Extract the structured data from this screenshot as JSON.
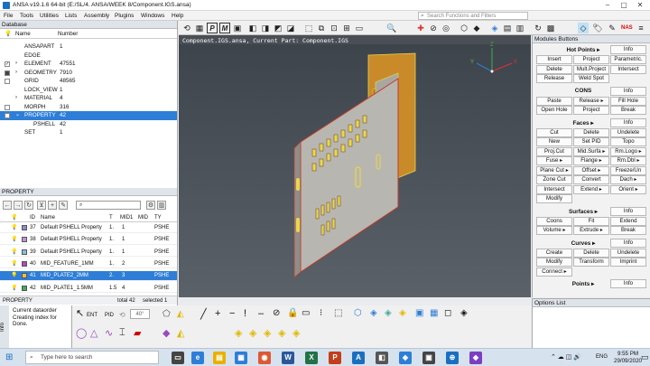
{
  "app": {
    "title": "ANSA v19.1.6 64-bit (E:/SL/4. ANSA/WEEK 8/Component.IGS.ansa)"
  },
  "menu": [
    "File",
    "Tools",
    "Utilities",
    "Lists",
    "Assembly",
    "Plugins",
    "Windows",
    "Help"
  ],
  "search": {
    "placeholder": "Search Functions and Filters"
  },
  "database": {
    "title": "Database",
    "col_name": "Name",
    "col_number": "Number",
    "rows": [
      {
        "name": "ANSAPART",
        "number": "1"
      },
      {
        "name": "EDGE",
        "number": ""
      },
      {
        "name": "ELEMENT",
        "number": "47551"
      },
      {
        "name": "GEOMETRY",
        "number": "7910"
      },
      {
        "name": "GRID",
        "number": "48565"
      },
      {
        "name": "LOCK_VIEW",
        "number": "1"
      },
      {
        "name": "MATERIAL",
        "number": "4"
      },
      {
        "name": "MORPH",
        "number": "316"
      },
      {
        "name": "PROPERTY",
        "number": "42"
      },
      {
        "name": "PSHELL",
        "number": "42"
      },
      {
        "name": "SET",
        "number": "1"
      }
    ]
  },
  "property": {
    "title": "PROPERTY",
    "headers": {
      "id": "ID",
      "name": "Name",
      "t": "T",
      "mid1": "MID1",
      "mid": "MID",
      "type": "TY"
    },
    "rows": [
      {
        "id": "37",
        "name": "Default PSHELL Property",
        "t": "1.",
        "mid1": "1",
        "type": "PSHE",
        "color": "#8a8ad0"
      },
      {
        "id": "38",
        "name": "Default PSHELL Property",
        "t": "1.",
        "mid1": "1",
        "type": "PSHE",
        "color": "#c98fd0"
      },
      {
        "id": "39",
        "name": "Default PSHELL Property",
        "t": "1.",
        "mid1": "1",
        "type": "PSHE",
        "color": "#8bc0e0"
      },
      {
        "id": "40",
        "name": "MID_FEATURE_1MM",
        "t": "1.",
        "mid1": "2",
        "type": "PSHE",
        "color": "#b04ab8"
      },
      {
        "id": "41",
        "name": "MID_PLATE2_2MM",
        "t": "2.",
        "mid1": "3",
        "type": "PSHE",
        "color": "#e8c23a"
      },
      {
        "id": "42",
        "name": "MID_PLATE1_1.5MM",
        "t": "1.5",
        "mid1": "4",
        "type": "PSHE",
        "color": "#3fae4c"
      }
    ],
    "footer_label": "PROPERTY",
    "footer_total": "total 42",
    "footer_selected": "selected 1"
  },
  "viewport": {
    "header": "Component.IGS.ansa,  Current Part: Component.IGS"
  },
  "modules": {
    "title": "Modules Buttons",
    "info": "Info",
    "hotpoints": {
      "title": "Hot Points ▸",
      "buttons": [
        "Insert",
        "Project",
        "Parametric.",
        "Delete",
        "Mult.Project",
        "Intersect",
        "Release",
        "Weld Spot"
      ]
    },
    "cons": {
      "title": "CONS",
      "buttons": [
        "Paste",
        "Release ▸",
        "Fill Hole",
        "Open Hole",
        "Project",
        "Break"
      ]
    },
    "faces": {
      "title": "Faces ▸",
      "buttons": [
        "Cut",
        "Delete",
        "Undelete",
        "New",
        "Set PID",
        "Topo",
        "Proj.Cut",
        "Mid.Surfa ▸",
        "Rm.Logo ▸",
        "Fuse ▸",
        "Flange ▸",
        "Rm.Dbl ▸",
        "Plane Cut ▸",
        "Offset ▸",
        "Freeze/Un",
        "Zone Cut",
        "Convert",
        "Dach ▸",
        "Intersect",
        "Extend ▸",
        "Orient ▸",
        "Modify"
      ]
    },
    "surfaces": {
      "title": "Surfaces ▸",
      "buttons": [
        "Coons",
        "Fit",
        "Extend",
        "Volume ▸",
        "Extrude ▸",
        "Break"
      ]
    },
    "curves": {
      "title": "Curves ▸",
      "buttons": [
        "Create",
        "Delete",
        "Undelete",
        "Modify",
        "Transform",
        "Imprint",
        "Connect ▸"
      ]
    },
    "points": {
      "title": "Points ▸"
    }
  },
  "options": {
    "title": "Options List"
  },
  "info": {
    "label": "Info",
    "lines": [
      "Current dataorder",
      "Creating index for",
      "Done."
    ]
  },
  "toolbar_bottom": {
    "angle": "40°",
    "ent": "ENT",
    "pid": "PID"
  },
  "taskbar": {
    "search_placeholder": "Type here to search",
    "time": "9:55 PM",
    "date": "29/09/2020",
    "lang": "ENG"
  },
  "colors": {
    "accent": "#2e7ed7",
    "sheet": "#b8b6b0",
    "feature": "#e8d84a",
    "edge": "#c23a2a"
  }
}
